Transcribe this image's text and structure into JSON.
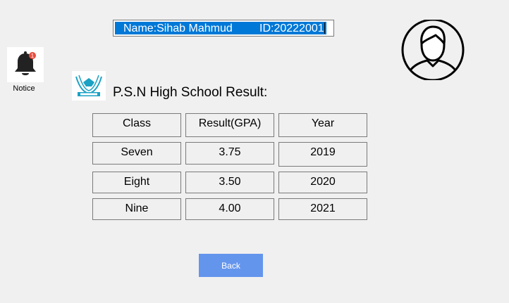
{
  "header": {
    "name_text": "Name:Sihab Mahmud",
    "id_text": "ID:20222001"
  },
  "notice": {
    "label": "Notice",
    "badge": "1"
  },
  "school": {
    "title": "P.S.N High School Result:",
    "logo_icon": "school-logo"
  },
  "table": {
    "headers": [
      "Class",
      "Result(GPA)",
      "Year"
    ],
    "rows": [
      [
        "Seven",
        "3.75",
        "2019"
      ],
      [
        "Eight",
        "3.50",
        "2020"
      ],
      [
        "Nine",
        "4.00",
        "2021"
      ]
    ]
  },
  "actions": {
    "back_label": "Back"
  },
  "colors": {
    "selection": "#0078d7",
    "back_button": "#6495ed",
    "background": "#f0f0f0"
  }
}
